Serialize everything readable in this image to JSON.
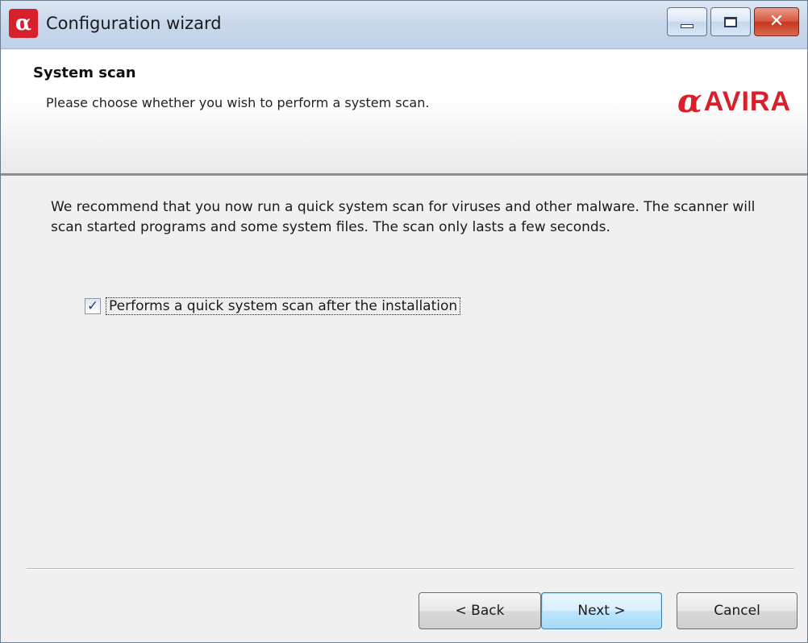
{
  "window": {
    "title": "Configuration wizard",
    "app_icon_glyph": "α",
    "caption": {
      "minimize": "▁",
      "maximize": "□",
      "close": "✕"
    }
  },
  "header": {
    "title": "System scan",
    "subtitle": "Please choose whether you wish to perform a system scan.",
    "brand_mark": "α",
    "brand_text": "AVIRA"
  },
  "body": {
    "description": "We recommend that you now run a quick system scan for viruses and other malware. The scanner will scan started programs and some system files. The scan only lasts a few seconds.",
    "checkbox": {
      "label": "Performs a quick system scan after the installation",
      "checked": true,
      "check_glyph": "✓"
    }
  },
  "footer": {
    "back_label": "< Back",
    "next_label": "Next >",
    "cancel_label": "Cancel"
  },
  "colors": {
    "brand_red": "#d8202c",
    "titlebar_blue": "#c9d9ec",
    "close_red": "#c5361c",
    "default_button_blue": "#3c7fb1"
  },
  "icons": [
    "avira-umbrella-icon",
    "minimize-icon",
    "maximize-icon",
    "close-icon",
    "checkmark-icon"
  ]
}
